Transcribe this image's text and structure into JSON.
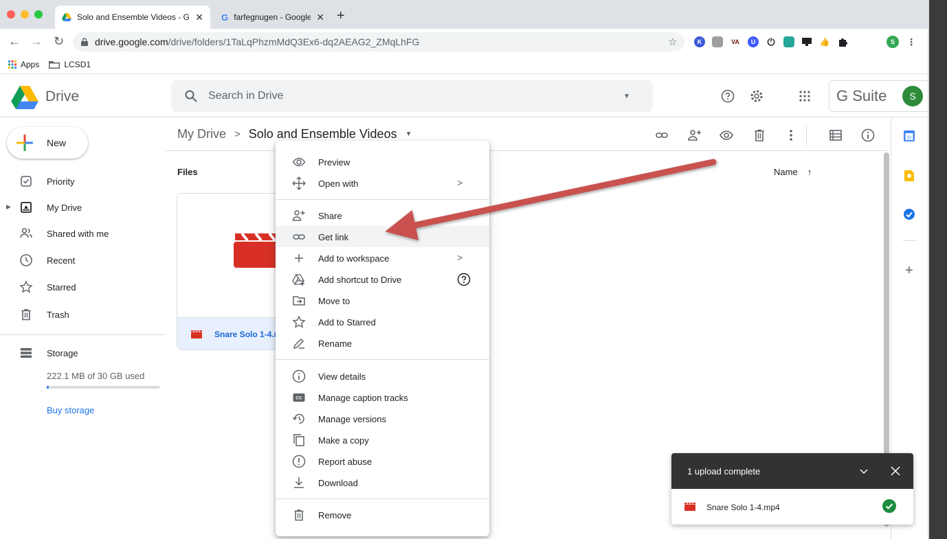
{
  "browser": {
    "tabs": [
      {
        "title": "Solo and Ensemble Videos - Goo",
        "close": "✕",
        "active": true
      },
      {
        "title": "farfegnugen - Google Search",
        "close": "✕",
        "active": false
      }
    ],
    "new_tab": "+",
    "url_host": "drive.google.com",
    "url_path": "/drive/folders/1TaLqPhzmMdQ3Ex6-dq2AEAG2_ZMqLhFG",
    "extensions": [
      {
        "name": "k-ext",
        "label": "K",
        "color": "#3b5bdb"
      },
      {
        "name": "reader-ext",
        "label": "",
        "color": "#9e9e9e"
      },
      {
        "name": "va-ext",
        "label": "VA",
        "color": "#6a1b1b"
      },
      {
        "name": "u-ext",
        "label": "U",
        "color": "#3d5afe"
      },
      {
        "name": "power-ext",
        "label": "⏻",
        "color": "#555555"
      },
      {
        "name": "cloud-ext",
        "label": "",
        "color": "#1e88e5"
      },
      {
        "name": "screen-ext",
        "label": "",
        "color": "#202124"
      },
      {
        "name": "thumb-ext",
        "label": "👍",
        "color": "#f9a825"
      },
      {
        "name": "puzzle-ext",
        "label": "",
        "color": "#5f6368"
      }
    ],
    "profile_initial": "S",
    "bookmarks": [
      {
        "label": "Apps"
      },
      {
        "label": "LCSD1"
      }
    ]
  },
  "header": {
    "app_name": "Drive",
    "search_placeholder": "Search in Drive",
    "gsuite_label": "G Suite",
    "avatar_initial": "S"
  },
  "sidebar": {
    "new_label": "New",
    "items": [
      {
        "label": "Priority"
      },
      {
        "label": "My Drive"
      },
      {
        "label": "Shared with me"
      },
      {
        "label": "Recent"
      },
      {
        "label": "Starred"
      },
      {
        "label": "Trash"
      }
    ],
    "storage_label": "Storage",
    "storage_used_text": "222.1 MB of 30 GB used",
    "storage_used_fraction": 0.007,
    "buy_storage": "Buy storage"
  },
  "main": {
    "breadcrumb_root": "My Drive",
    "breadcrumb_sep": ">",
    "breadcrumb_current": "Solo and Ensemble Videos",
    "files_label": "Files",
    "sort_label": "Name",
    "sort_arrow": "↑",
    "file": {
      "name": "Snare Solo 1-4.mp4"
    }
  },
  "context_menu": {
    "items": [
      {
        "label": "Preview"
      },
      {
        "label": "Open with",
        "submenu": ">"
      },
      {
        "label": "Share"
      },
      {
        "label": "Get link"
      },
      {
        "label": "Add to workspace",
        "submenu": ">"
      },
      {
        "label": "Add shortcut to Drive"
      },
      {
        "label": "Move to"
      },
      {
        "label": "Add to Starred"
      },
      {
        "label": "Rename"
      },
      {
        "label": "View details"
      },
      {
        "label": "Manage caption tracks"
      },
      {
        "label": "Manage versions"
      },
      {
        "label": "Make a copy"
      },
      {
        "label": "Report abuse"
      },
      {
        "label": "Download"
      },
      {
        "label": "Remove"
      }
    ]
  },
  "upload_toast": {
    "title": "1 upload complete",
    "file_name": "Snare Solo 1-4.mp4"
  },
  "colors": {
    "accent_blue": "#1a73e8",
    "annotation_arrow": "#c9524f",
    "video_red": "#d93025",
    "success_green": "#1e8e3e"
  }
}
